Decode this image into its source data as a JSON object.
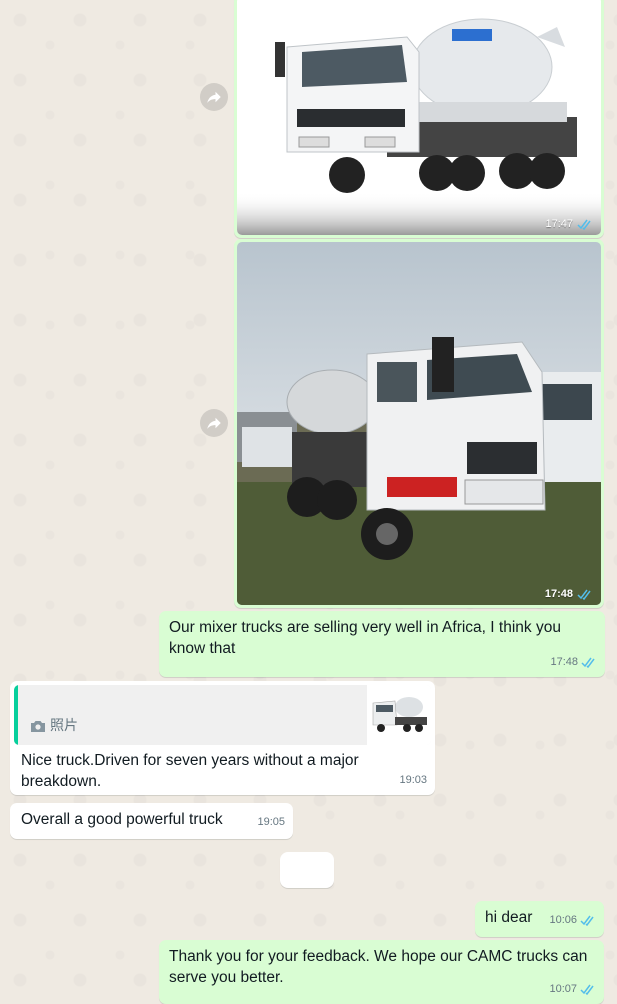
{
  "colors": {
    "outgoing_bubble": "#d9fdd3",
    "incoming_bubble": "#ffffff",
    "read_ticks": "#53bdeb",
    "quote_accent": "#06cf9c",
    "wallpaper": "#efeae2"
  },
  "messages": [
    {
      "type": "image",
      "direction": "out",
      "time": "17:47",
      "status": "read",
      "subject": "white CAMC concrete mixer truck"
    },
    {
      "type": "image",
      "direction": "out",
      "time": "17:48",
      "status": "read",
      "subject": "mixer trucks parked outdoors"
    },
    {
      "type": "text",
      "direction": "out",
      "text": "Our mixer trucks are selling very well in Africa, I think you know that",
      "time": "17:48",
      "status": "read"
    },
    {
      "type": "reply",
      "direction": "in",
      "quoted_label": "照片",
      "quoted_icon": "camera-icon",
      "text": "Nice truck.Driven for seven years without a major breakdown.",
      "time": "19:03"
    },
    {
      "type": "text",
      "direction": "in",
      "text": "Overall a good powerful truck",
      "time": "19:05"
    },
    {
      "type": "text",
      "direction": "out",
      "text": "hi dear",
      "time": "10:06",
      "status": "read"
    },
    {
      "type": "text",
      "direction": "out",
      "text": "Thank you for your feedback. We hope our CAMC trucks can serve you better.",
      "time": "10:07",
      "status": "read"
    }
  ]
}
